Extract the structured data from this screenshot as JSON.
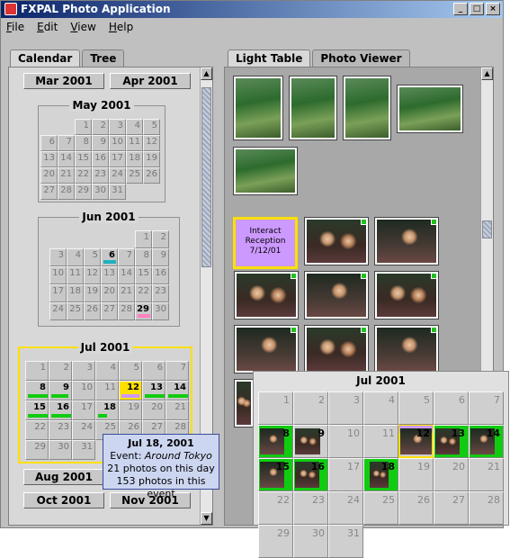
{
  "window": {
    "title": "FXPAL Photo Application",
    "min": "_",
    "max": "□",
    "close": "×"
  },
  "menu": [
    "File",
    "Edit",
    "View",
    "Help"
  ],
  "left_tabs": [
    "Calendar",
    "Tree"
  ],
  "right_tabs": [
    "Light Table",
    "Photo Viewer"
  ],
  "months": {
    "mar": "Mar 2001",
    "apr": "Apr 2001",
    "may": "May 2001",
    "jun": "Jun 2001",
    "jul": "Jul 2001",
    "aug": "Aug 2001",
    "oct": "Oct 2001",
    "nov": "Nov 2001"
  },
  "may_days": [
    [
      "",
      "",
      "1",
      "2",
      "3",
      "4",
      "5"
    ],
    [
      "6",
      "7",
      "8",
      "9",
      "10",
      "11",
      "12"
    ],
    [
      "13",
      "14",
      "15",
      "16",
      "17",
      "18",
      "19"
    ],
    [
      "20",
      "21",
      "22",
      "23",
      "24",
      "25",
      "26"
    ],
    [
      "27",
      "28",
      "29",
      "30",
      "31",
      "",
      ""
    ]
  ],
  "jun_days": [
    [
      "",
      "",
      "",
      "",
      "",
      "1",
      "2"
    ],
    [
      "3",
      "4",
      "5",
      "6",
      "7",
      "8",
      "9"
    ],
    [
      "10",
      "11",
      "12",
      "13",
      "14",
      "15",
      "16"
    ],
    [
      "17",
      "18",
      "19",
      "20",
      "21",
      "22",
      "23"
    ],
    [
      "24",
      "25",
      "26",
      "27",
      "28",
      "29",
      "30"
    ]
  ],
  "jul_days": [
    [
      "1",
      "2",
      "3",
      "4",
      "5",
      "6",
      "7"
    ],
    [
      "8",
      "9",
      "10",
      "11",
      "12",
      "13",
      "14"
    ],
    [
      "15",
      "16",
      "17",
      "18",
      "19",
      "20",
      "21"
    ],
    [
      "22",
      "23",
      "24",
      "25",
      "26",
      "27",
      "28"
    ],
    [
      "29",
      "30",
      "31",
      "",
      "",
      "",
      ""
    ]
  ],
  "event_card": {
    "line1": "Interact",
    "line2": "Reception",
    "line3": "7/12/01"
  },
  "tooltip": {
    "date": "Jul 18, 2001",
    "event_label": "Event: ",
    "event_name": "Around Tokyo",
    "photos_day": "21 photos on this day",
    "photos_event": "153 photos in this event"
  },
  "zoom_title": "Jul 2001",
  "colors": {
    "green": "#10cc10",
    "pink": "#cc99ff",
    "teal": "#20b0c0",
    "rose": "#ff80c0",
    "yellow": "#ffe000"
  }
}
